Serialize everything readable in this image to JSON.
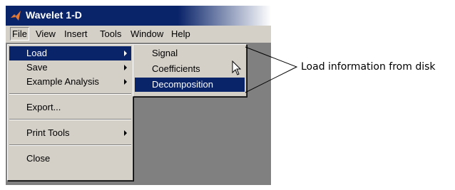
{
  "window": {
    "title": "Wavelet 1-D"
  },
  "menubar": {
    "items": [
      {
        "label": "File",
        "mnemonic": "F"
      },
      {
        "label": "View",
        "mnemonic": "V"
      },
      {
        "label": "Insert",
        "mnemonic": "I"
      },
      {
        "label": "Tools",
        "mnemonic": "T"
      },
      {
        "label": "Window",
        "mnemonic": "W"
      },
      {
        "label": "Help",
        "mnemonic": "H"
      }
    ]
  },
  "file_menu": {
    "items": [
      {
        "label": "Load",
        "has_submenu": true,
        "highlighted": true
      },
      {
        "label": "Save",
        "has_submenu": true
      },
      {
        "label": "Example Analysis",
        "has_submenu": true
      },
      {
        "label": "Export..."
      },
      {
        "label": "Print Tools",
        "has_submenu": true
      },
      {
        "label": "Close"
      }
    ]
  },
  "load_submenu": {
    "items": [
      {
        "label": "Signal"
      },
      {
        "label": "Coefficients"
      },
      {
        "label": "Decomposition",
        "highlighted": true
      }
    ]
  },
  "callout": {
    "text": "Load information from disk"
  },
  "colors": {
    "titlebar": "#0a246a",
    "highlight": "#0a246a",
    "menu_bg": "#d4d0c8",
    "workspace": "#808080"
  }
}
